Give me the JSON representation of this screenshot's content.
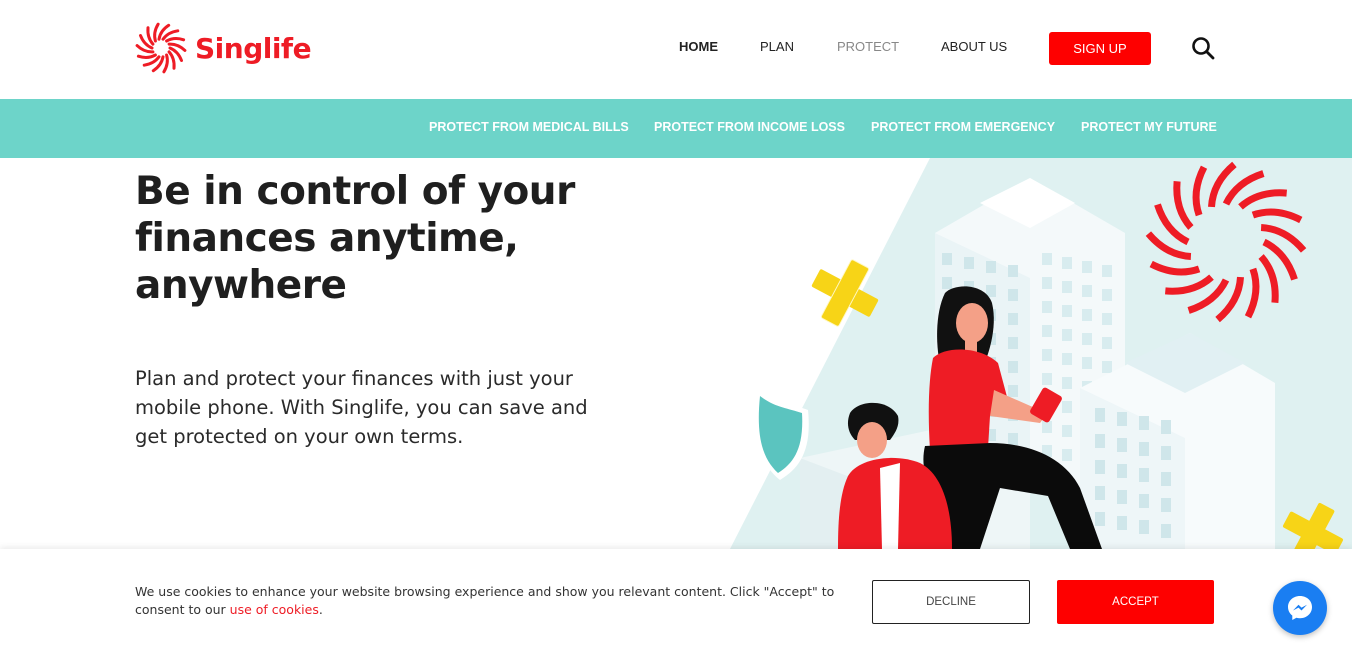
{
  "brand": {
    "name": "Singlife",
    "color": "#ee1c25",
    "logo_icon": "sunburst-logo-icon"
  },
  "nav": {
    "items": [
      {
        "label": "HOME",
        "state": "active"
      },
      {
        "label": "PLAN",
        "state": "normal"
      },
      {
        "label": "PROTECT",
        "state": "muted"
      },
      {
        "label": "ABOUT US",
        "state": "normal"
      }
    ],
    "signup_label": "SIGN UP",
    "search_icon": "search-icon"
  },
  "subnav": {
    "background": "#6dd4c9",
    "items": [
      "PROTECT FROM MEDICAL BILLS",
      "PROTECT FROM INCOME LOSS",
      "PROTECT FROM EMERGENCY",
      "PROTECT MY FUTURE"
    ]
  },
  "hero": {
    "title_lines": [
      "Be in control of your",
      "finances anytime,",
      "anywhere"
    ],
    "description_lines": [
      "Plan and protect your finances with just your",
      "mobile phone. With Singlife, you can save and",
      "get protected on your own terms."
    ]
  },
  "cookie": {
    "text": "We use cookies to enhance your website browsing experience and show you relevant content. Click \"Accept\" to consent to our ",
    "link_text": "use of cookies",
    "suffix": ".",
    "decline_label": "DECLINE",
    "accept_label": "ACCEPT"
  },
  "chat": {
    "icon": "messenger-icon",
    "color": "#1a7ef2"
  },
  "colors": {
    "accent_red": "#fe0000",
    "teal": "#6dd4c9",
    "yellow": "#f7d417"
  }
}
